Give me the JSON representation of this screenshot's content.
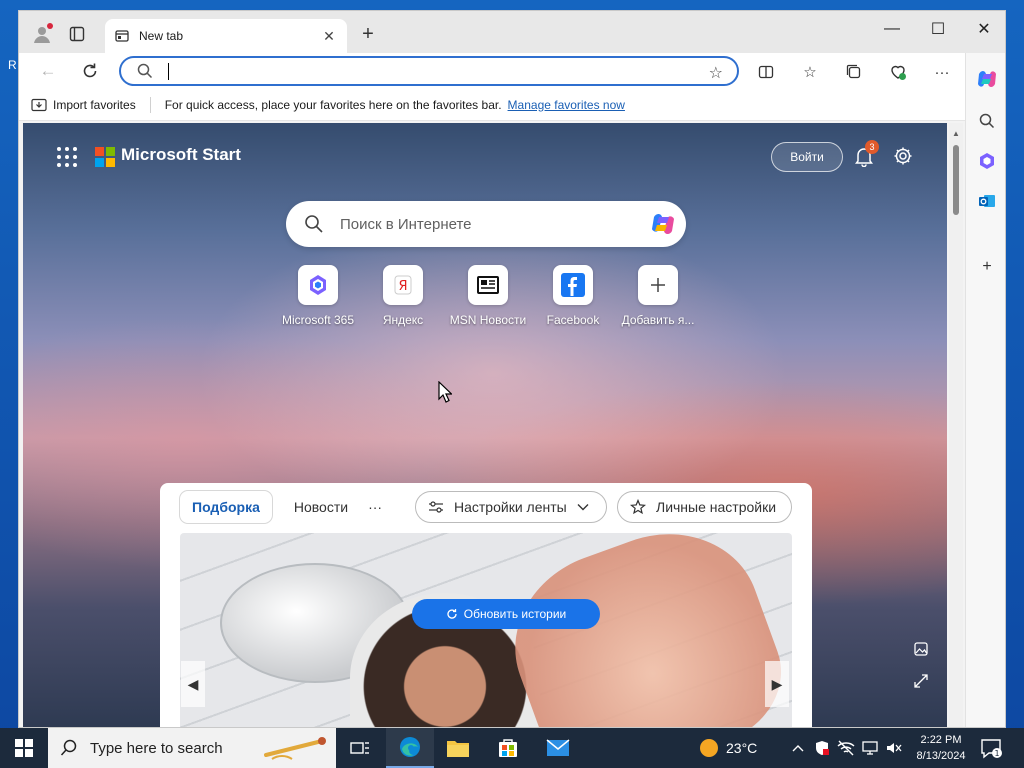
{
  "desktop": {
    "edge_letter": "R"
  },
  "window": {
    "tab": {
      "label": "New tab"
    },
    "controls": {
      "minimize": "—",
      "maximize": "☐",
      "close": "✕"
    }
  },
  "toolbar": {
    "address": {
      "value": "",
      "placeholder": ""
    }
  },
  "favorites_bar": {
    "import_label": "Import favorites",
    "message": "For quick access, place your favorites here on the favorites bar.",
    "manage_link": "Manage favorites now"
  },
  "start_page": {
    "brand": "Microsoft Start",
    "signin_label": "Войти",
    "notification_count": "3",
    "search_placeholder": "Поиск в Интернете",
    "quick_links": [
      {
        "label": "Microsoft 365",
        "icon": "m365-icon"
      },
      {
        "label": "Яндекс",
        "icon": "yandex-icon"
      },
      {
        "label": "MSN Новости",
        "icon": "msn-news-icon"
      },
      {
        "label": "Facebook",
        "icon": "facebook-icon"
      },
      {
        "label": "Добавить я...",
        "icon": "add-icon"
      }
    ],
    "feed": {
      "tabs": [
        {
          "label": "Подборка",
          "active": true
        },
        {
          "label": "Новости",
          "active": false
        }
      ],
      "more": "···",
      "feed_settings_label": "Настройки ленты",
      "personal_settings_label": "Личные настройки",
      "refresh_label": "Обновить истории"
    }
  },
  "taskbar": {
    "search_placeholder": "Type here to search",
    "temperature": "23°C",
    "time": "2:22 PM",
    "date": "8/13/2024",
    "notification_count": "1"
  },
  "colors": {
    "accent": "#1a73e8",
    "link": "#1a5fb4",
    "ms_red": "#f25022",
    "ms_green": "#7fba00",
    "ms_blue": "#00a4ef",
    "ms_yellow": "#ffb900"
  }
}
